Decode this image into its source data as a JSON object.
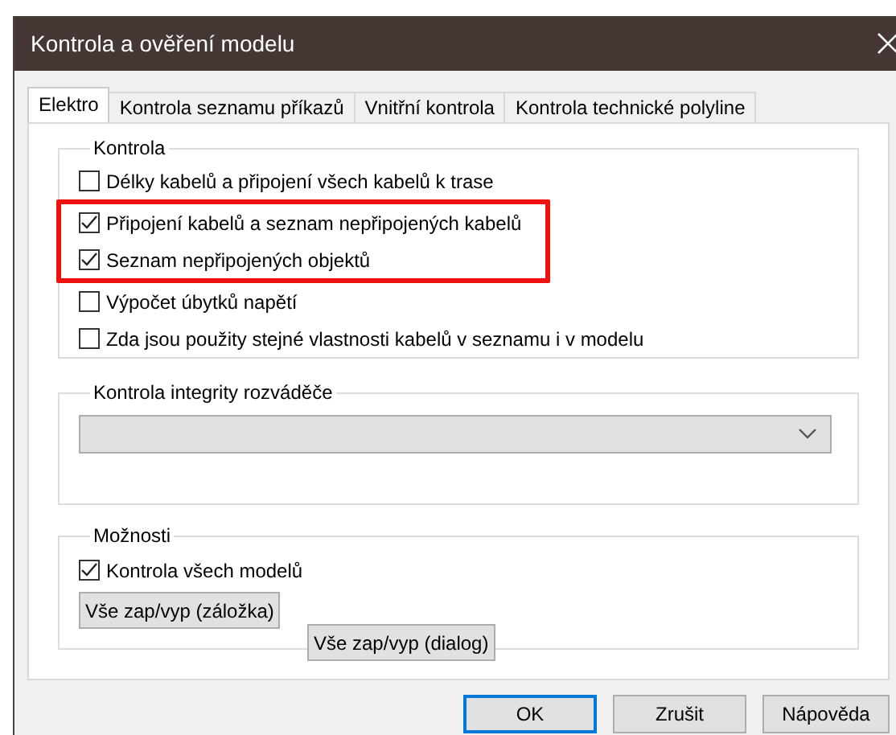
{
  "window": {
    "title": "Kontrola a ověření modelu"
  },
  "tabs": [
    {
      "label": "Elektro",
      "selected": true
    },
    {
      "label": "Kontrola seznamu příkazů",
      "selected": false
    },
    {
      "label": "Vnitřní kontrola",
      "selected": false
    },
    {
      "label": "Kontrola technické polyline",
      "selected": false
    }
  ],
  "check_group": {
    "title": "Kontrola",
    "items": [
      {
        "label": "Délky kabelů a připojení všech kabelů k trase",
        "checked": false,
        "highlighted": false
      },
      {
        "label": "Připojení kabelů a seznam nepřipojených kabelů",
        "checked": true,
        "highlighted": true
      },
      {
        "label": "Seznam nepřipojených objektů",
        "checked": true,
        "highlighted": true
      },
      {
        "label": "Výpočet úbytků napětí",
        "checked": false,
        "highlighted": false
      },
      {
        "label": "Zda jsou použity stejné vlastnosti kabelů v seznamu i v modelu",
        "checked": false,
        "highlighted": false
      }
    ]
  },
  "integrity_group": {
    "title": "Kontrola  integrity rozváděče",
    "dropdown": {
      "disabled": true
    }
  },
  "options_group": {
    "title": "Možnosti",
    "checkbox": {
      "label": "Kontrola všech modelů",
      "checked": true
    },
    "buttons": [
      "Vše zap/vyp (záložka)",
      "Vše zap/vyp (dialog)"
    ]
  },
  "buttons": [
    {
      "label": "OK",
      "default": true
    },
    {
      "label": "Zrušit",
      "default": false
    },
    {
      "label": "Nápověda",
      "default": false
    }
  ]
}
